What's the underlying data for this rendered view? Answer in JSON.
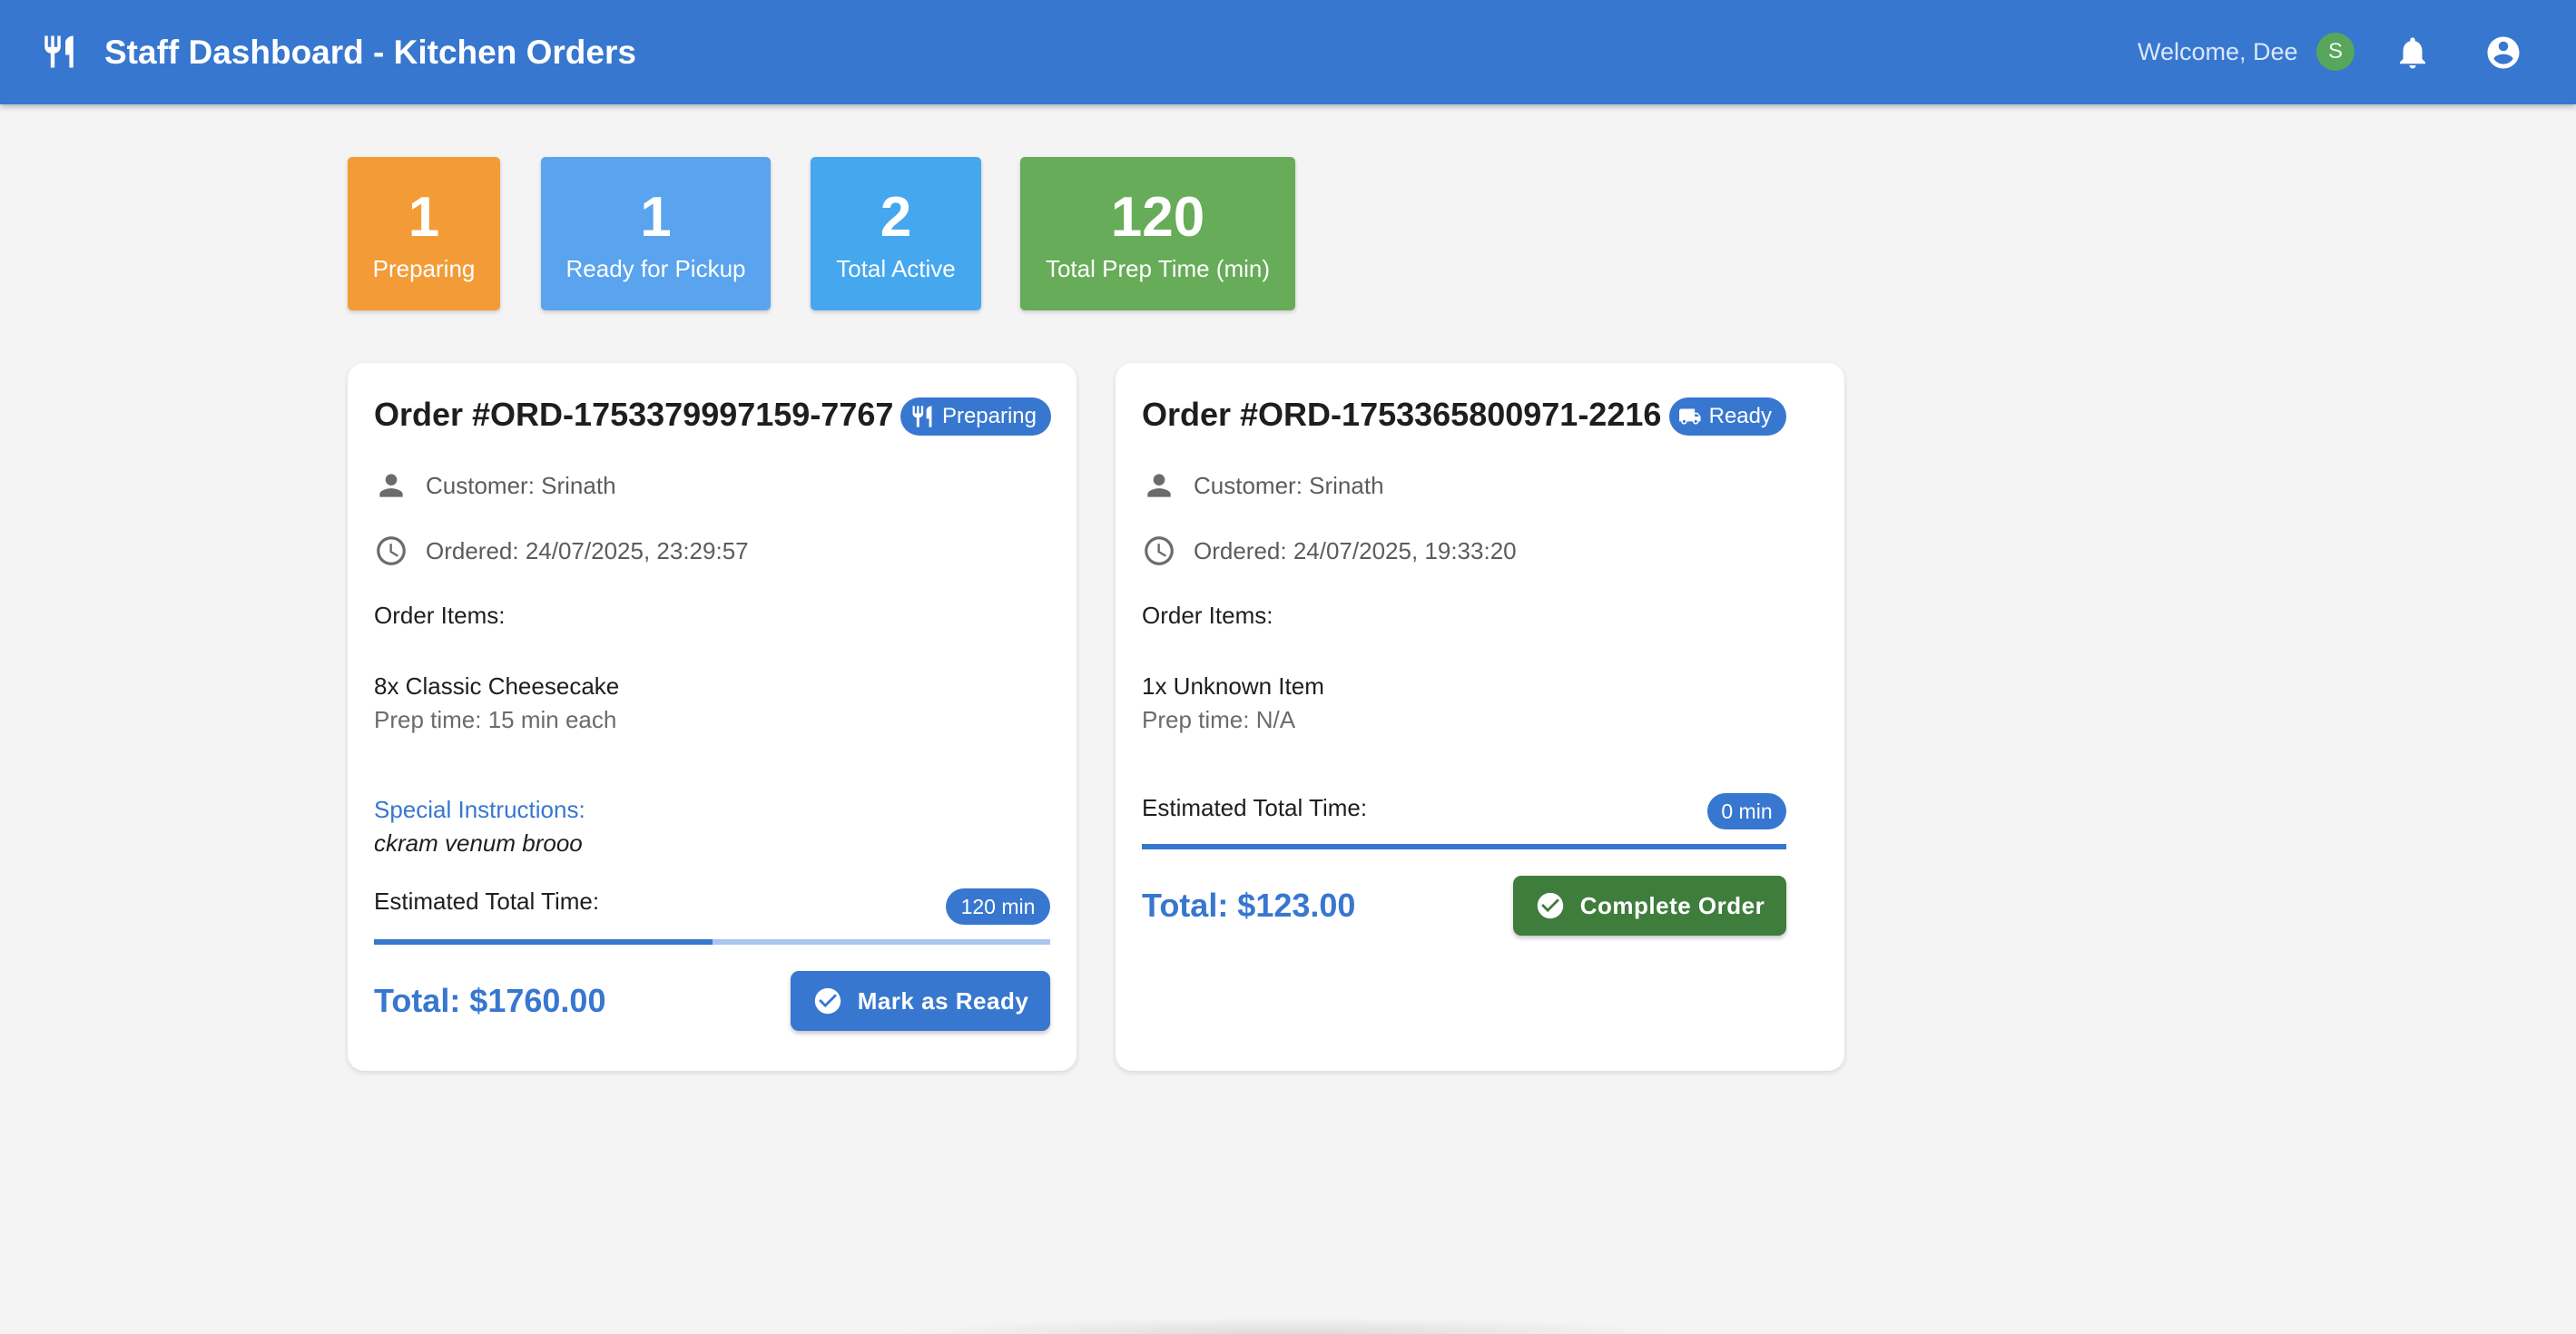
{
  "header": {
    "title": "Staff Dashboard - Kitchen Orders",
    "welcome": "Welcome, Dee",
    "avatar_initial": "S",
    "logo_icon": "restaurant-icon",
    "notification_icon": "bell-icon",
    "account_icon": "account-circle-icon",
    "bar_color": "#3777cf"
  },
  "stats": [
    {
      "value": "1",
      "label": "Preparing",
      "color": "#f39c37"
    },
    {
      "value": "1",
      "label": "Ready for Pickup",
      "color": "#5aa3ee"
    },
    {
      "value": "2",
      "label": "Total Active",
      "color": "#45a7ee"
    },
    {
      "value": "120",
      "label": "Total Prep Time (min)",
      "color": "#67ac58"
    }
  ],
  "orders": [
    {
      "title": "Order #ORD-1753379997159-7767",
      "status": "Preparing",
      "status_icon": "restaurant-icon",
      "customer": "Customer: Srinath",
      "ordered": "Ordered: 24/07/2025, 23:29:57",
      "items_heading": "Order Items:",
      "item": "8x Classic Cheesecake",
      "prep": "Prep time: 15 min each",
      "special_heading": "Special Instructions:",
      "special_text": "ckram venum brooo",
      "est_label": "Estimated Total Time:",
      "est_value": "120 min",
      "progress_fraction": 0.5,
      "total": "Total: $1760.00",
      "action": "Mark as Ready",
      "action_color": "#3777cf"
    },
    {
      "title": "Order #ORD-1753365800971-2216",
      "status": "Ready",
      "status_icon": "truck-icon",
      "customer": "Customer: Srinath",
      "ordered": "Ordered: 24/07/2025, 19:33:20",
      "items_heading": "Order Items:",
      "item": "1x Unknown Item",
      "prep": "Prep time: N/A",
      "est_label": "Estimated Total Time:",
      "est_value": "0 min",
      "progress_fraction": 1.0,
      "total": "Total: $123.00",
      "action": "Complete Order",
      "action_color": "#3f7d3c"
    }
  ]
}
